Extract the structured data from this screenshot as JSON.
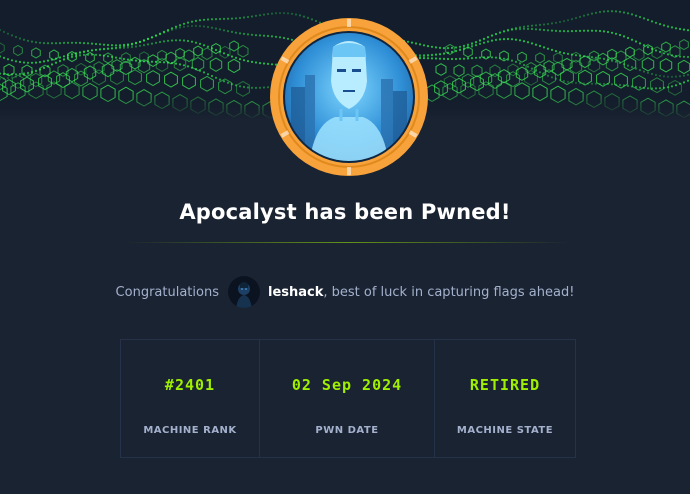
{
  "header": {
    "banner_icon": "green-hexagon-wave-pattern",
    "machine_badge_icon": "android-face-machine-avatar"
  },
  "title": "Apocalyst has been Pwned!",
  "congrats": {
    "prefix": "Congratulations",
    "username": "leshack",
    "suffix": ", best of luck in capturing flags ahead!",
    "avatar_icon": "dark-user-avatar"
  },
  "stats": [
    {
      "value": "#2401",
      "label": "MACHINE RANK"
    },
    {
      "value": "02 Sep 2024",
      "label": "PWN DATE"
    },
    {
      "value": "RETIRED",
      "label": "MACHINE STATE"
    }
  ],
  "colors": {
    "background": "#1a2332",
    "accent": "#9fef00",
    "badge_ring": "#f7a23a",
    "text_muted": "#a4b1cd",
    "text_primary": "#ffffff"
  }
}
